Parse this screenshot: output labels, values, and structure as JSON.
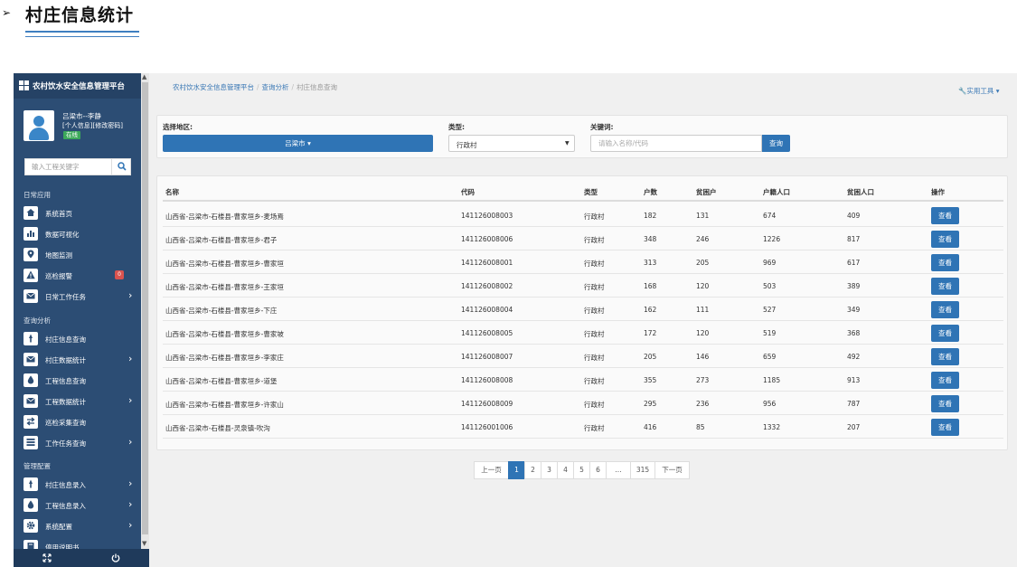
{
  "doc": {
    "heading": "村庄信息统计"
  },
  "app": {
    "brand": "农村饮水安全信息管理平台",
    "user": {
      "name": "吕梁市--李静",
      "profile_link": "[个人信息]",
      "password_link": "[修改密码]",
      "status": "在线"
    },
    "sidebar_search": {
      "placeholder": "输入工程关键字"
    },
    "sections": [
      "日常应用",
      "查询分析",
      "管理配置"
    ],
    "menu": [
      {
        "label": "系统首页",
        "icon": "home-icon",
        "chevron": false
      },
      {
        "label": "数据可视化",
        "icon": "bar-chart-icon",
        "chevron": false
      },
      {
        "label": "地图监测",
        "icon": "map-marker-icon",
        "chevron": false
      },
      {
        "label": "巡检报警",
        "icon": "warning-icon",
        "chevron": false,
        "badge": "0"
      },
      {
        "label": "日常工作任务",
        "icon": "envelope-icon",
        "chevron": true
      },
      {
        "label": "村庄信息查询",
        "icon": "tint-icon",
        "chevron": false
      },
      {
        "label": "村庄数据统计",
        "icon": "envelope-icon",
        "chevron": true
      },
      {
        "label": "工程信息查询",
        "icon": "drop-icon",
        "chevron": false
      },
      {
        "label": "工程数据统计",
        "icon": "envelope-icon",
        "chevron": true
      },
      {
        "label": "巡检采集查询",
        "icon": "exchange-icon",
        "chevron": false
      },
      {
        "label": "工作任务查询",
        "icon": "list-icon",
        "chevron": true
      },
      {
        "label": "村庄信息录入",
        "icon": "tint-icon",
        "chevron": true
      },
      {
        "label": "工程信息录入",
        "icon": "drop-icon",
        "chevron": true
      },
      {
        "label": "系统配置",
        "icon": "gear-icon",
        "chevron": true
      },
      {
        "label": "停用说明书",
        "icon": "book-icon",
        "chevron": false
      }
    ],
    "breadcrumb": [
      "农村饮水安全信息管理平台",
      "查询分析",
      "村庄信息查询"
    ],
    "tools_label": "实用工具",
    "filters": {
      "region_label": "选择地区:",
      "region_value": "吕梁市",
      "type_label": "类型:",
      "type_value": "行政村",
      "keyword_label": "关键词:",
      "keyword_placeholder": "请输入名称/代码",
      "query_label": "查询"
    },
    "table": {
      "columns": [
        "名称",
        "代码",
        "类型",
        "户数",
        "贫困户",
        "户籍人口",
        "贫困人口",
        "操作"
      ],
      "action_label": "查看",
      "rows": [
        [
          "山西省-吕梁市-石楼县-曹家垣乡-麦场焉",
          "141126008003",
          "行政村",
          "182",
          "131",
          "674",
          "409"
        ],
        [
          "山西省-吕梁市-石楼县-曹家垣乡-君子",
          "141126008006",
          "行政村",
          "348",
          "246",
          "1226",
          "817"
        ],
        [
          "山西省-吕梁市-石楼县-曹家垣乡-曹家垣",
          "141126008001",
          "行政村",
          "313",
          "205",
          "969",
          "617"
        ],
        [
          "山西省-吕梁市-石楼县-曹家垣乡-王家垣",
          "141126008002",
          "行政村",
          "168",
          "120",
          "503",
          "389"
        ],
        [
          "山西省-吕梁市-石楼县-曹家垣乡-下庄",
          "141126008004",
          "行政村",
          "162",
          "111",
          "527",
          "349"
        ],
        [
          "山西省-吕梁市-石楼县-曹家垣乡-曹家坡",
          "141126008005",
          "行政村",
          "172",
          "120",
          "519",
          "368"
        ],
        [
          "山西省-吕梁市-石楼县-曹家垣乡-李家庄",
          "141126008007",
          "行政村",
          "205",
          "146",
          "659",
          "492"
        ],
        [
          "山西省-吕梁市-石楼县-曹家垣乡-道堡",
          "141126008008",
          "行政村",
          "355",
          "273",
          "1185",
          "913"
        ],
        [
          "山西省-吕梁市-石楼县-曹家垣乡-许家山",
          "141126008009",
          "行政村",
          "295",
          "236",
          "956",
          "787"
        ],
        [
          "山西省-吕梁市-石楼县-灵泉镇-吹沟",
          "141126001006",
          "行政村",
          "416",
          "85",
          "1332",
          "207"
        ]
      ]
    },
    "pagination": {
      "prev": "上一页",
      "pages": [
        "1",
        "2",
        "3",
        "4",
        "5",
        "6",
        "...",
        "315"
      ],
      "next": "下一页",
      "active": "1"
    }
  }
}
